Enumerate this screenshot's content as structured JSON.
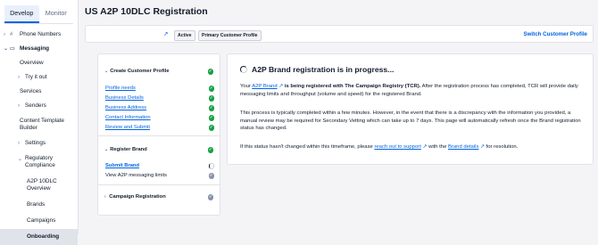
{
  "sidebar": {
    "tabs": [
      {
        "label": "Develop",
        "active": true
      },
      {
        "label": "Monitor",
        "active": false
      }
    ],
    "items": [
      {
        "label": "Phone Numbers",
        "chevron": "›",
        "icon": "#"
      },
      {
        "label": "Messaging",
        "chevron": "⌄",
        "icon": "▭"
      },
      {
        "label": "Overview"
      },
      {
        "label": "Try it out",
        "chevron": "›"
      },
      {
        "label": "Services"
      },
      {
        "label": "Senders",
        "chevron": "›"
      },
      {
        "label": "Content Template Builder"
      },
      {
        "label": "Settings",
        "chevron": "›"
      },
      {
        "label": "Regulatory Compliance",
        "chevron": "⌄"
      },
      {
        "label": "A2P 10DLC Overview"
      },
      {
        "label": "Brands"
      },
      {
        "label": "Campaigns"
      },
      {
        "label": "Onboarding"
      }
    ]
  },
  "header": {
    "title": "US A2P 10DLC Registration",
    "badges": [
      "Active",
      "Primary Customer Profile"
    ],
    "switch_link": "Switch Customer Profile"
  },
  "steps": {
    "create_profile": {
      "title": "Create Customer Profile",
      "items": [
        "Profile needs",
        "Business Details",
        "Business Address",
        "Contact Information",
        "Review and Submit"
      ]
    },
    "register_brand": {
      "title": "Register Brand",
      "items": [
        "Submit Brand",
        "View A2P messaging limits"
      ]
    },
    "campaign": {
      "title": "Campaign Registration"
    }
  },
  "status": {
    "heading": "A2P Brand registration is in progress...",
    "p1_prefix": "Your",
    "p1_link": "A2P Brand",
    "p1_bold": "is being registered with The Campaign Registry (TCR).",
    "p1_rest": "After the registration process has completed, TCR will provide daily messaging limits and throughput (volume and speed) for the registered Brand.",
    "p2": "This process is typically completed within a few minutes. However, in the event that there is a discrepancy with the information you provided, a manual review may be required for Secondary Vetting which can take up to 7 days. This page will automatically refresh once the Brand registration status has changed.",
    "p3_prefix": "If this status hasn't changed within this timeframe, please",
    "p3_link1": "reach out to support",
    "p3_mid": "with the",
    "p3_link2": "Brand details",
    "p3_suffix": "for resolution."
  },
  "colors": {
    "accent": "#0263e0",
    "success": "#14a045",
    "neutral_icon": "#8891aa"
  }
}
